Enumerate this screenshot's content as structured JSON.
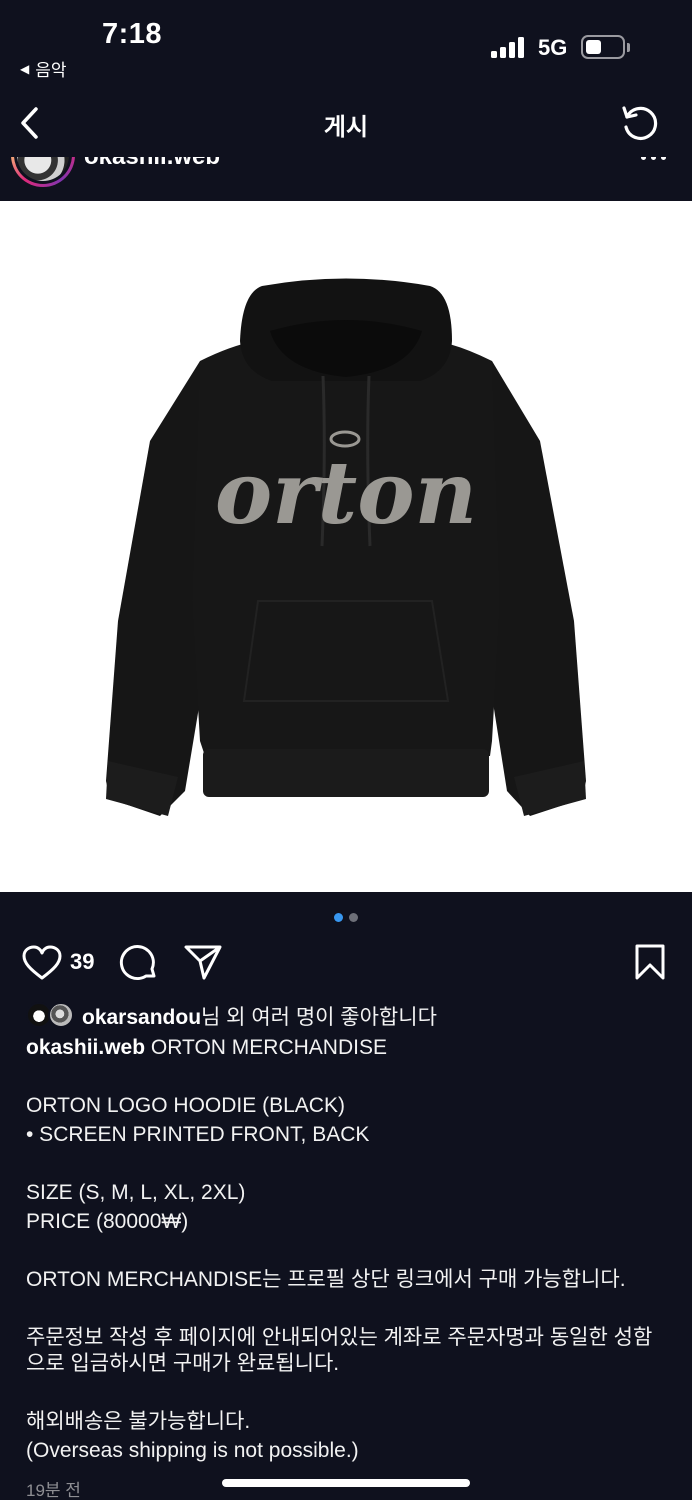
{
  "status_bar": {
    "time": "7:18",
    "back_label": "음악",
    "network": "5G",
    "signal_bars": 4,
    "battery_level": 0.35
  },
  "nav": {
    "title": "게시",
    "back_icon": "chevron-left-icon",
    "refresh_icon": "refresh-icon"
  },
  "post": {
    "username": "okashii.web",
    "image": {
      "logo_text": "orton",
      "alt": "ORTON LOGO HOODIE (BLACK)"
    },
    "carousel": {
      "count": 2,
      "active": 0
    },
    "likes_count": "39",
    "liked_by_user": "okarsandou",
    "liked_by_suffix": "님 외 여러 명이 좋아합니다",
    "caption_user": "okashii.web",
    "caption_lines": [
      "ORTON MERCHANDISE",
      "",
      "ORTON LOGO HOODIE (BLACK)",
      "• SCREEN PRINTED FRONT, BACK",
      "",
      "SIZE (S, M, L, XL, 2XL)",
      "PRICE (80000₩)",
      "",
      "ORTON MERCHANDISE는 프로필 상단 링크에서 구매 가능합니다.",
      "",
      "주문정보 작성 후 페이지에 안내되어있는 계좌로 주문자명과 동일한 성함",
      "으로 입금하시면 구매가 완료됩니다.",
      "",
      "해외배송은 불가능합니다.",
      "(Overseas shipping is not possible.)"
    ],
    "timestamp": "19분 전"
  },
  "colors": {
    "background": "#0f111e",
    "accent_dot": "#3897f0",
    "hoodie": "#161616",
    "logo_print": "#9a9893"
  }
}
